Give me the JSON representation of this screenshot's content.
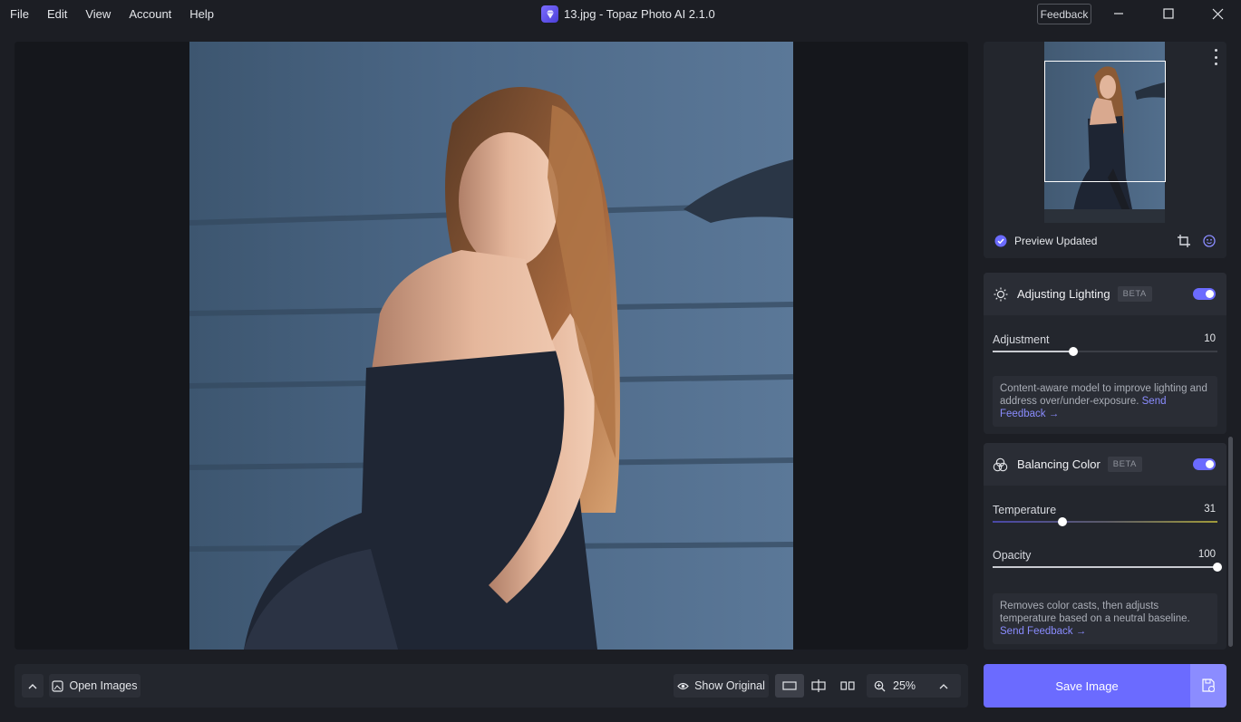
{
  "menu": [
    "File",
    "Edit",
    "View",
    "Account",
    "Help"
  ],
  "window": {
    "title": "13.jpg - Topaz Photo AI 2.1.0",
    "feedback_label": "Feedback"
  },
  "preview": {
    "status": "Preview Updated"
  },
  "lighting": {
    "title": "Adjusting Lighting",
    "badge": "BETA",
    "enabled": true,
    "param_label": "Adjustment",
    "param_value": "10",
    "param_level": 10,
    "desc_text": "Content-aware model to improve lighting and address over/under-exposure. ",
    "desc_link": "Send Feedback →"
  },
  "color": {
    "title": "Balancing Color",
    "badge": "BETA",
    "enabled": true,
    "temperature_label": "Temperature",
    "temperature_value": "31",
    "temperature_level": 31,
    "opacity_label": "Opacity",
    "opacity_value": "100",
    "opacity_level": 100,
    "desc_text": "Removes color casts, then adjusts temperature based on a neutral baseline. ",
    "desc_link": "Send Feedback →"
  },
  "bottom": {
    "open_images": "Open Images",
    "show_original": "Show Original",
    "zoom": "25%"
  },
  "save": {
    "label": "Save Image"
  },
  "colors": {
    "accent": "#6b6bff",
    "panel": "#23262d",
    "background": "#1c1e24"
  }
}
